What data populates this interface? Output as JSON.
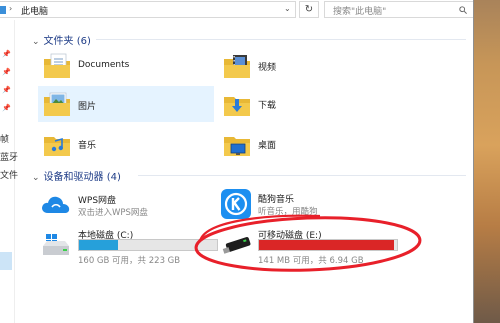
{
  "address_bar": {
    "chevron": "›",
    "path": "此电脑",
    "dropdown": "⌄",
    "refresh_glyph": "↻",
    "search_placeholder": "搜索\"此电脑\""
  },
  "nav_pane": {
    "fragments": [
      "帧",
      "蓝牙",
      "文件"
    ]
  },
  "groups": {
    "folders": {
      "header": "文件夹 (6)",
      "items": [
        {
          "label": "Documents",
          "icon": "documents-folder-icon"
        },
        {
          "label": "视频",
          "icon": "videos-folder-icon"
        },
        {
          "label": "图片",
          "icon": "pictures-folder-icon"
        },
        {
          "label": "下载",
          "icon": "downloads-folder-icon"
        },
        {
          "label": "音乐",
          "icon": "music-folder-icon"
        },
        {
          "label": "桌面",
          "icon": "desktop-folder-icon"
        }
      ]
    },
    "devices": {
      "header": "设备和驱动器 (4)",
      "items": [
        {
          "label": "WPS网盘",
          "sub": "双击进入WPS网盘",
          "icon": "wps-cloud-icon"
        },
        {
          "label": "酷狗音乐",
          "sub": "听音乐，用酷狗",
          "icon": "kugou-music-icon"
        },
        {
          "label": "本地磁盘 (C:)",
          "sub": "160 GB 可用，共 223 GB",
          "icon": "windows-drive-icon",
          "usage": 0.283,
          "bar_color": "#26a0da"
        },
        {
          "label": "可移动磁盘 (E:)",
          "sub": "141 MB 可用，共 6.94 GB",
          "icon": "usb-drive-icon",
          "usage": 0.98,
          "bar_color": "#da2626"
        }
      ]
    }
  },
  "colors": {
    "header_blue": "#1e3c87",
    "folder_yellow": "#f3c94c",
    "selection": "#e5f3ff",
    "annotation_red": "#e8202a"
  }
}
